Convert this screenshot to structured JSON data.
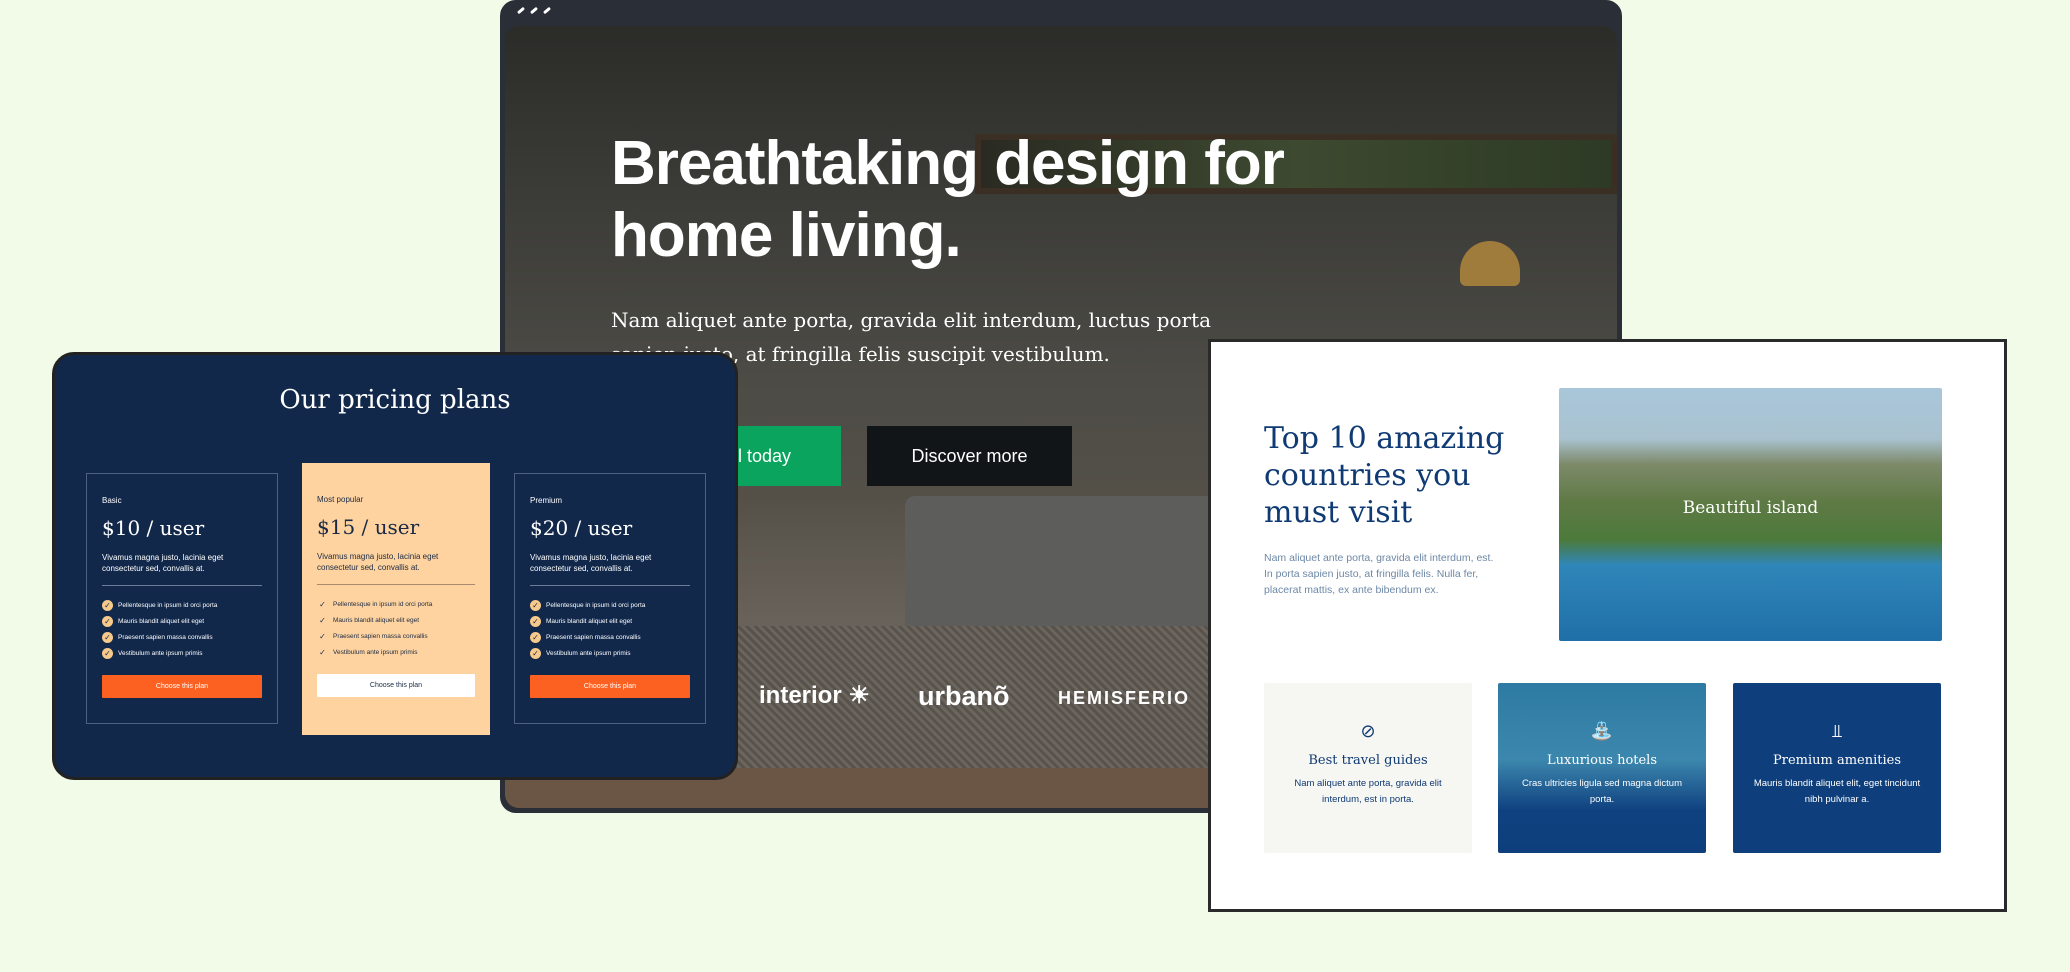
{
  "hero": {
    "headline": "Breathtaking design for home living.",
    "text": "Nam aliquet ante porta, gravida elit interdum, luctus porta sapien justo, at fringilla felis suscipit vestibulum.",
    "primary_button": "l today",
    "secondary_button": "Discover more",
    "logos": [
      "interior ☀",
      "urbanõ",
      "HEMISFERIO"
    ],
    "accent": "#0aa45f"
  },
  "pricing": {
    "title": "Our pricing plans",
    "plans": [
      {
        "tier": "Basic",
        "price": "$10 / user",
        "desc": "Vivamus magna justo, lacinia eget consectetur sed, convallis at.",
        "features": [
          "Pellentesque in ipsum id orci porta",
          "Mauris blandit aliquet elit eget",
          "Praesent sapien massa convallis",
          "Vestibulum ante ipsum primis"
        ],
        "button": "Choose this plan"
      },
      {
        "tier": "Most popular",
        "price": "$15 / user",
        "desc": "Vivamus magna justo, lacinia eget consectetur sed, convallis at.",
        "features": [
          "Pellentesque in ipsum id orci porta",
          "Mauris blandit aliquet elit eget",
          "Praesent sapien massa convallis",
          "Vestibulum ante ipsum primis"
        ],
        "button": "Choose this plan"
      },
      {
        "tier": "Premium",
        "price": "$20 / user",
        "desc": "Vivamus magna justo, lacinia eget consectetur sed, convallis at.",
        "features": [
          "Pellentesque in ipsum id orci porta",
          "Mauris blandit aliquet elit eget",
          "Praesent sapien massa convallis",
          "Vestibulum ante ipsum primis"
        ],
        "button": "Choose this plan"
      }
    ],
    "button_color": "#fd6122",
    "popular_bg": "#fed39f"
  },
  "travel": {
    "title": "Top 10 amazing countries you must visit",
    "lead": "Nam aliquet ante porta, gravida elit interdum, est. In porta sapien justo, at fringilla felis. Nulla fer, placerat mattis, ex ante bibendum ex.",
    "image_caption": "Beautiful island",
    "features": [
      {
        "icon": "compass-icon",
        "title": "Best travel guides",
        "text": "Nam aliquet ante porta, gravida elit interdum, est in porta."
      },
      {
        "icon": "shower-icon",
        "title": "Luxurious hotels",
        "text": "Cras ultricies ligula sed magna dictum porta."
      },
      {
        "icon": "pool-icon",
        "title": "Premium amenities",
        "text": "Mauris blandit aliquet elit, eget tincidunt nibh pulvinar a."
      }
    ]
  }
}
